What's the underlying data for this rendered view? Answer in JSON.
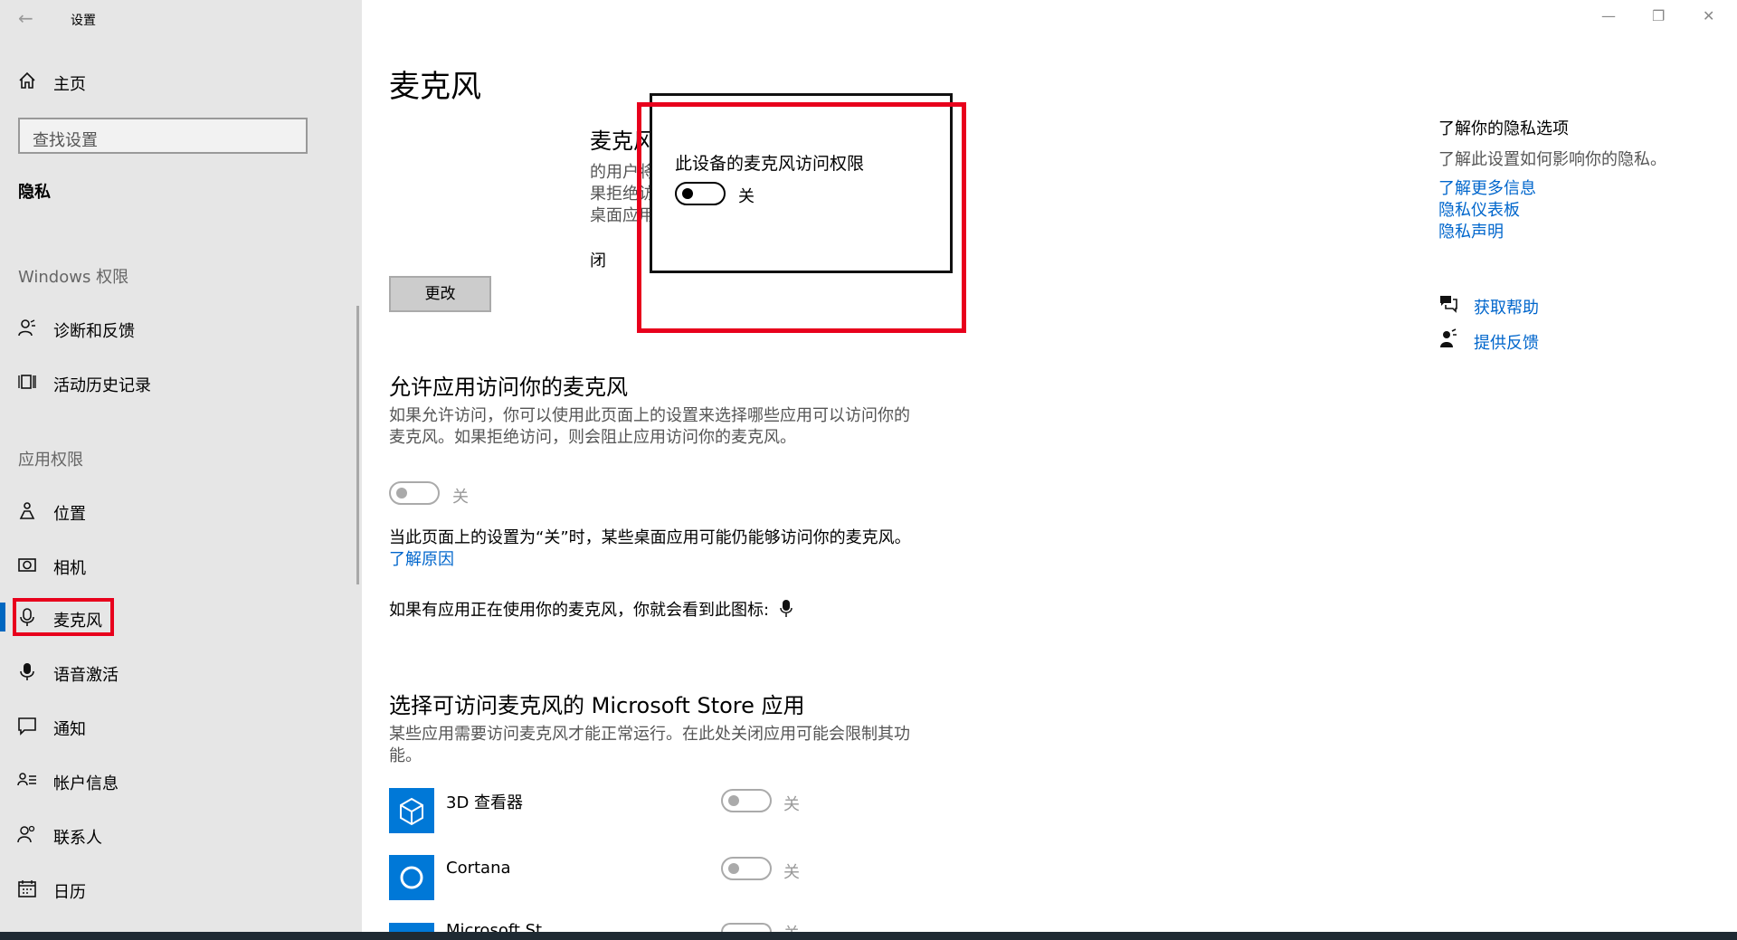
{
  "window": {
    "title": "设置",
    "back_icon": "back-arrow-icon",
    "minimize_glyph": "—",
    "restore_glyph": "❐",
    "close_glyph": "✕"
  },
  "sidebar": {
    "home": {
      "icon": "home-icon",
      "label": "主页"
    },
    "search": {
      "placeholder": "查找设置"
    },
    "privacy_heading": "隐私",
    "windows_group": "Windows 权限",
    "windows_items": [
      {
        "icon": "diagnostics-icon",
        "label": "诊断和反馈"
      },
      {
        "icon": "activity-history-icon",
        "label": "活动历史记录"
      }
    ],
    "app_group": "应用权限",
    "app_items": [
      {
        "icon": "location-icon",
        "label": "位置"
      },
      {
        "icon": "camera-icon",
        "label": "相机"
      },
      {
        "icon": "microphone-icon",
        "label": "麦克风",
        "selected": true
      },
      {
        "icon": "voice-activation-icon",
        "label": "语音激活"
      },
      {
        "icon": "notification-icon",
        "label": "通知"
      },
      {
        "icon": "account-info-icon",
        "label": "帐户信息"
      },
      {
        "icon": "contacts-icon",
        "label": "联系人"
      },
      {
        "icon": "calendar-icon",
        "label": "日历"
      }
    ]
  },
  "main": {
    "page_title": "麦克风",
    "device_section": {
      "title_fragment": "麦克风",
      "desc_fragments": [
        "的用户将可以使用该页面上的设置来选择其",
        "果拒绝访问，则会阻止 Windows 功能、",
        "桌面应用访问麦克风。"
      ],
      "status_fragment": "闭",
      "change_button": "更改"
    },
    "popup": {
      "title": "此设备的麦克风访问权限",
      "toggle_label": "关",
      "toggle_on": false
    },
    "allow_apps": {
      "title": "允许应用访问你的麦克风",
      "desc": "如果允许访问，你可以使用此页面上的设置来选择哪些应用可以访问你的麦克风。如果拒绝访问，则会阻止应用访问你的麦克风。",
      "toggle_label": "关",
      "toggle_on": false,
      "note": "当此页面上的设置为“关”时，某些桌面应用可能仍能够访问你的麦克风。",
      "learn_why": "了解原因",
      "icon_note": "如果有应用正在使用你的麦克风，你就会看到此图标:"
    },
    "store_apps": {
      "title": "选择可访问麦克风的 Microsoft Store 应用",
      "desc": "某些应用需要访问麦克风才能正常运行。在此处关闭应用可能会限制其功能。",
      "apps": [
        {
          "icon": "3d-viewer-icon",
          "name": "3D 查看器",
          "toggle_label": "关",
          "toggle_on": false
        },
        {
          "icon": "cortana-icon",
          "name": "Cortana",
          "toggle_label": "关",
          "toggle_on": false
        },
        {
          "icon": "microsoft-store-app-icon",
          "name": "Microsoft St",
          "toggle_label": "关",
          "toggle_on": false
        }
      ]
    }
  },
  "right_panel": {
    "title": "了解你的隐私选项",
    "desc": "了解此设置如何影响你的隐私。",
    "links": [
      "了解更多信息",
      "隐私仪表板",
      "隐私声明"
    ],
    "help": {
      "icon": "get-help-icon",
      "label": "获取帮助"
    },
    "feedback": {
      "icon": "feedback-icon",
      "label": "提供反馈"
    }
  },
  "colors": {
    "sidebar_bg": "#e6e6e6",
    "accent": "#0067c0",
    "link": "#0066cc",
    "highlight": "#e8001c",
    "app_tile": "#0078d7"
  }
}
